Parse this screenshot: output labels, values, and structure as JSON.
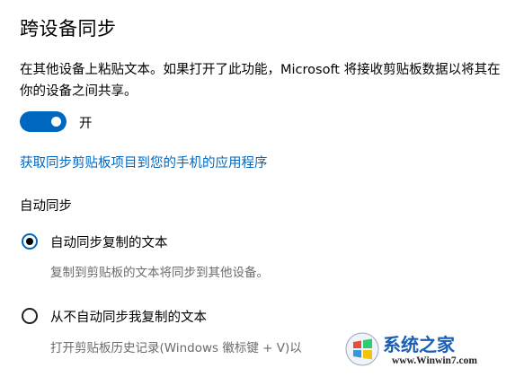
{
  "page_title": "跨设备同步",
  "description": "在其他设备上粘贴文本。如果打开了此功能，Microsoft 将接收剪贴板数据以将其在你的设备之间共享。",
  "toggle": {
    "state": "on",
    "label": "开"
  },
  "phone_link": "获取同步剪贴板项目到您的手机的应用程序",
  "auto_sync": {
    "heading": "自动同步",
    "options": [
      {
        "label": "自动同步复制的文本",
        "sublabel": "复制到剪贴板的文本将同步到其他设备。",
        "selected": true
      },
      {
        "label": "从不自动同步我复制的文本",
        "sublabel": "打开剪贴板历史记录(Windows 徽标键 + V)以",
        "selected": false
      }
    ]
  },
  "watermark": {
    "text": "系统之家",
    "site": "www.Winwin7.com",
    "logo_icon": "windows-flag-logo"
  },
  "colors": {
    "accent": "#0067c0",
    "secondary_text": "#6b6b6b"
  }
}
